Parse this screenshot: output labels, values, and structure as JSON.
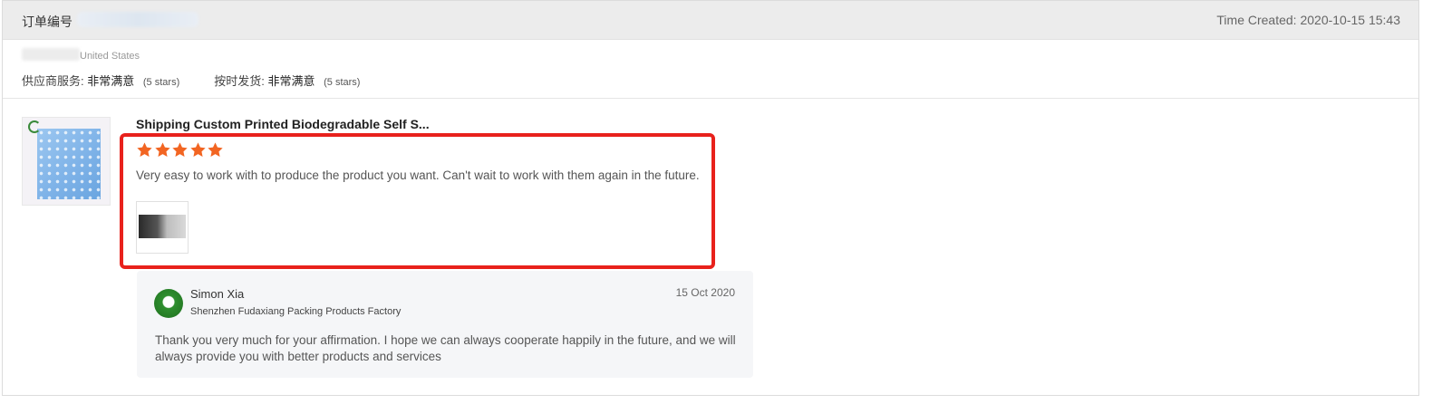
{
  "header": {
    "order_label": "订单编号",
    "time_created": "Time Created: 2020-10-15 15:43"
  },
  "buyer": {
    "country": "United States"
  },
  "ratings": [
    {
      "label": "供应商服务:",
      "value": "非常满意",
      "stars_note": "(5 stars)"
    },
    {
      "label": "按时发货:",
      "value": "非常满意",
      "stars_note": "(5 stars)"
    }
  ],
  "product": {
    "title": "Shipping Custom Printed Biodegradable Self S..."
  },
  "review": {
    "stars": 5,
    "star_color": "#f26522",
    "text": "Very easy to work with to produce the product you want. Can't wait to work with them again in the future.",
    "highlight_color": "#e8211c"
  },
  "reply": {
    "name": "Simon Xia",
    "company": "Shenzhen Fudaxiang Packing Products Factory",
    "date": "15 Oct 2020",
    "text": "Thank you very much for your affirmation. I hope we can always cooperate happily in the future, and we will always provide you with better products and services"
  }
}
